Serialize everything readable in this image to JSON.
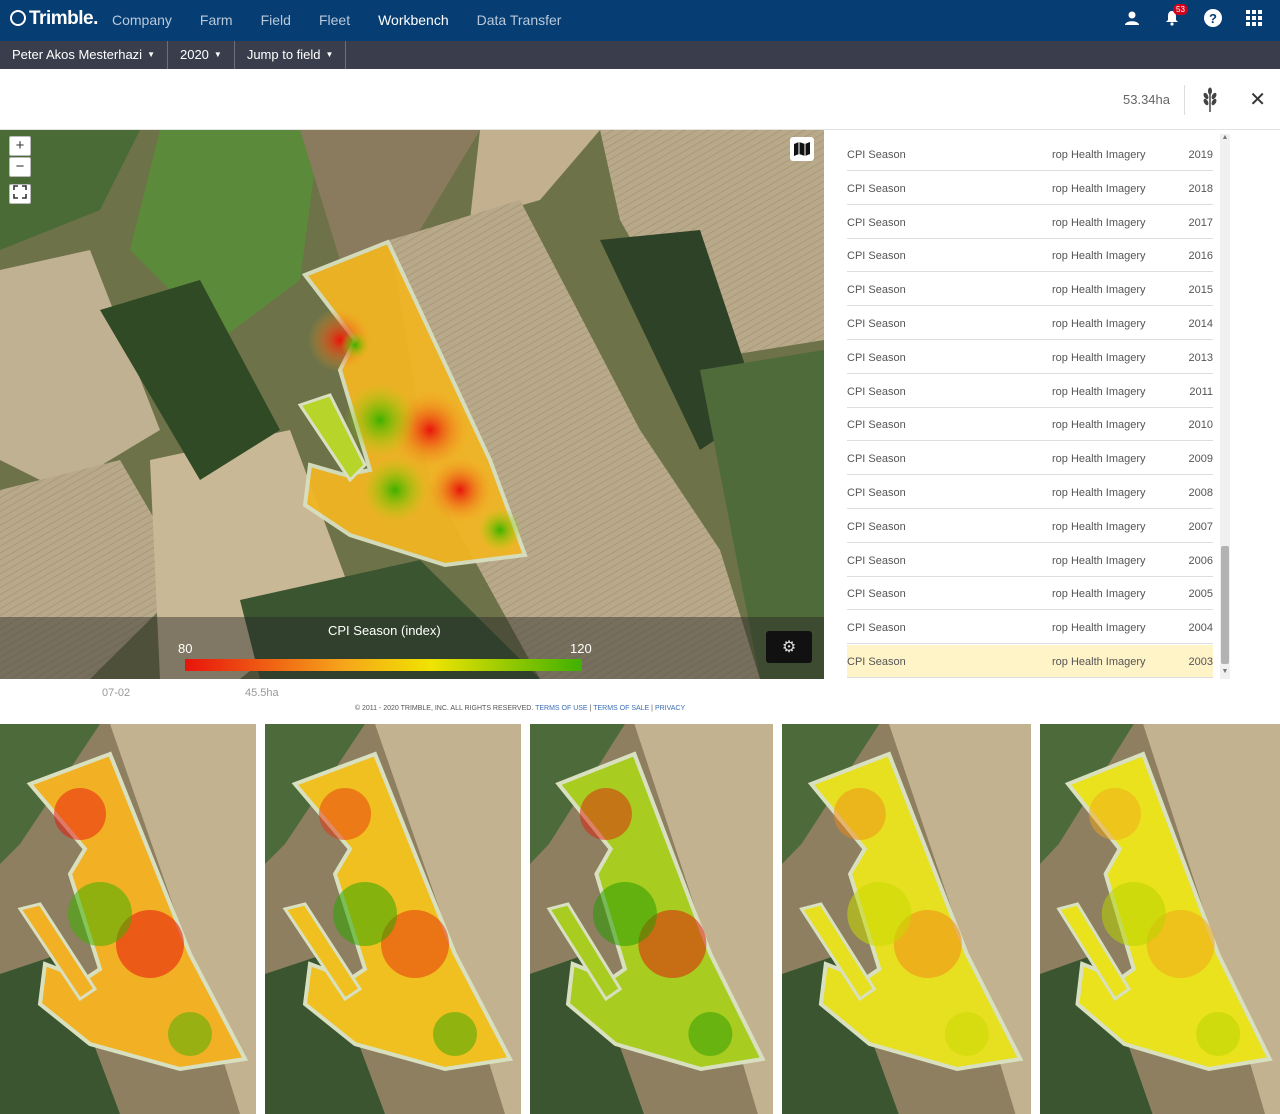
{
  "brand": {
    "logo_text": "Trimble."
  },
  "nav": {
    "items": [
      "Company",
      "Farm",
      "Field",
      "Fleet",
      "Workbench",
      "Data Transfer"
    ],
    "active": "Workbench"
  },
  "topbar": {
    "notification_count": "53"
  },
  "subbar": {
    "user": "Peter Akos Mesterhazi",
    "year": "2020",
    "jump": "Jump to field"
  },
  "header": {
    "area": "53.34ha"
  },
  "legend": {
    "title": "CPI Season (index)",
    "min": "80",
    "max": "120",
    "colors": [
      "#e8140c",
      "#f6a51a",
      "#f0e400",
      "#3fb000"
    ]
  },
  "layers": [
    {
      "name": "CPI Season",
      "kind": "rop Health Imagery",
      "year": "2019"
    },
    {
      "name": "CPI Season",
      "kind": "rop Health Imagery",
      "year": "2018"
    },
    {
      "name": "CPI Season",
      "kind": "rop Health Imagery",
      "year": "2017"
    },
    {
      "name": "CPI Season",
      "kind": "rop Health Imagery",
      "year": "2016"
    },
    {
      "name": "CPI Season",
      "kind": "rop Health Imagery",
      "year": "2015"
    },
    {
      "name": "CPI Season",
      "kind": "rop Health Imagery",
      "year": "2014"
    },
    {
      "name": "CPI Season",
      "kind": "rop Health Imagery",
      "year": "2013"
    },
    {
      "name": "CPI Season",
      "kind": "rop Health Imagery",
      "year": "2011"
    },
    {
      "name": "CPI Season",
      "kind": "rop Health Imagery",
      "year": "2010"
    },
    {
      "name": "CPI Season",
      "kind": "rop Health Imagery",
      "year": "2009"
    },
    {
      "name": "CPI Season",
      "kind": "rop Health Imagery",
      "year": "2008"
    },
    {
      "name": "CPI Season",
      "kind": "rop Health Imagery",
      "year": "2007"
    },
    {
      "name": "CPI Season",
      "kind": "rop Health Imagery",
      "year": "2006"
    },
    {
      "name": "CPI Season",
      "kind": "rop Health Imagery",
      "year": "2005"
    },
    {
      "name": "CPI Season",
      "kind": "rop Health Imagery",
      "year": "2004"
    },
    {
      "name": "CPI Season",
      "kind": "rop Health Imagery",
      "year": "2003",
      "selected": true
    }
  ],
  "under_row": {
    "date": "07-02",
    "area": "45.5ha"
  },
  "footer": {
    "copyright": "© 2011 - 2020 TRIMBLE, INC. ALL RIGHTS RESERVED.",
    "links": [
      "TERMS OF USE",
      "TERMS OF SALE",
      "PRIVACY"
    ]
  }
}
